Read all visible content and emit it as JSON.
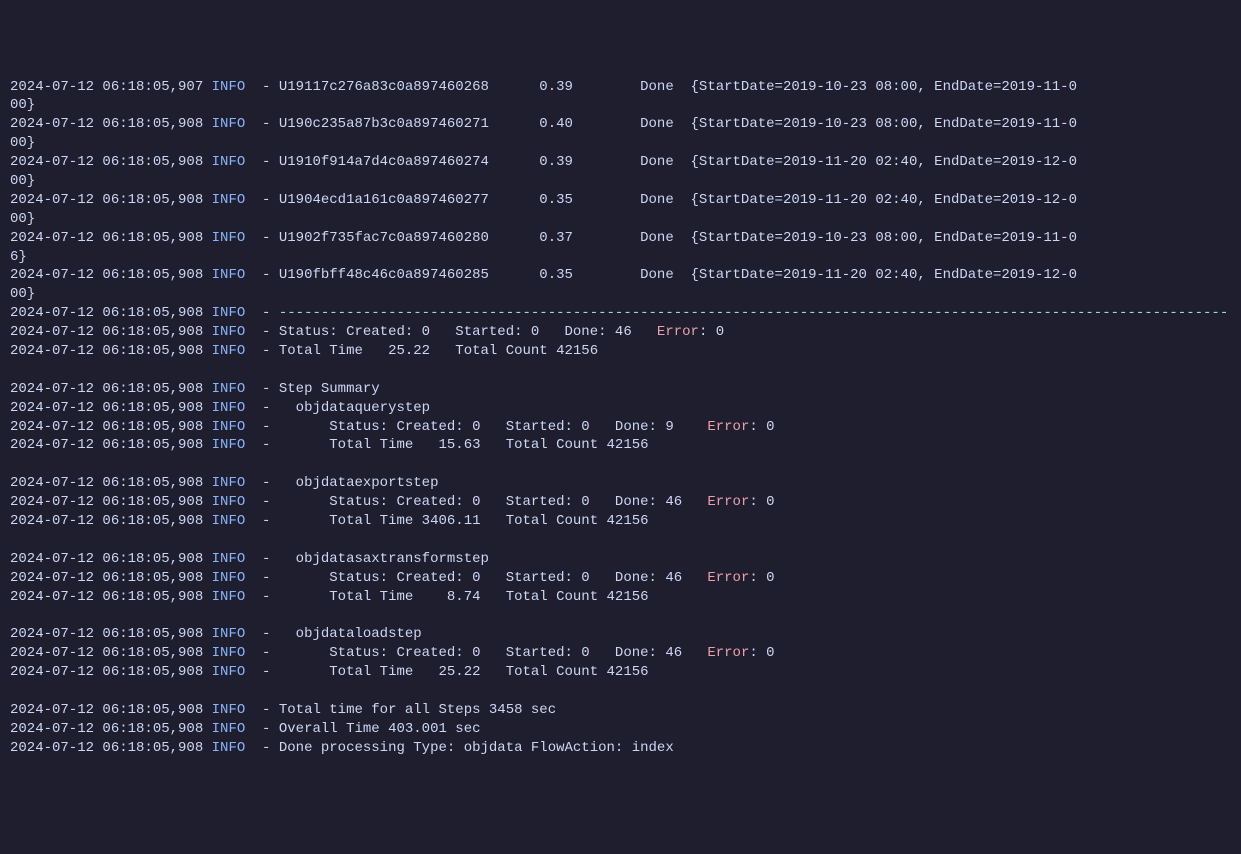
{
  "lines": [
    {
      "ts": "2024-07-12 06:18:05,907",
      "level": "INFO",
      "dash": "-",
      "id": "U19117c276a83c0a897460268",
      "val": "0.39",
      "status": "Done",
      "params": "{StartDate=2019-10-23 08:00, EndDate=2019-11-0"
    },
    {
      "wrap": "00}"
    },
    {
      "ts": "2024-07-12 06:18:05,908",
      "level": "INFO",
      "dash": "-",
      "id": "U190c235a87b3c0a897460271",
      "val": "0.40",
      "status": "Done",
      "params": "{StartDate=2019-10-23 08:00, EndDate=2019-11-0"
    },
    {
      "wrap": "00}"
    },
    {
      "ts": "2024-07-12 06:18:05,908",
      "level": "INFO",
      "dash": "-",
      "id": "U1910f914a7d4c0a897460274",
      "val": "0.39",
      "status": "Done",
      "params": "{StartDate=2019-11-20 02:40, EndDate=2019-12-0"
    },
    {
      "wrap": "00}"
    },
    {
      "ts": "2024-07-12 06:18:05,908",
      "level": "INFO",
      "dash": "-",
      "id": "U1904ecd1a161c0a897460277",
      "val": "0.35",
      "status": "Done",
      "params": "{StartDate=2019-11-20 02:40, EndDate=2019-12-0"
    },
    {
      "wrap": "00}"
    },
    {
      "ts": "2024-07-12 06:18:05,908",
      "level": "INFO",
      "dash": "-",
      "id": "U1902f735fac7c0a897460280",
      "val": "0.37",
      "status": "Done",
      "params": "{StartDate=2019-10-23 08:00, EndDate=2019-11-0"
    },
    {
      "wrap": "6}"
    },
    {
      "ts": "2024-07-12 06:18:05,908",
      "level": "INFO",
      "dash": "-",
      "id": "U190fbff48c46c0a897460285",
      "val": "0.35",
      "status": "Done",
      "params": "{StartDate=2019-11-20 02:40, EndDate=2019-12-0"
    },
    {
      "wrap": "00}"
    },
    {
      "ts": "2024-07-12 06:18:05,908",
      "level": "INFO",
      "dash": "-",
      "separator": true
    },
    {
      "ts": "2024-07-12 06:18:05,908",
      "level": "INFO",
      "dash": "-",
      "statusLine": {
        "created": "0",
        "started": "0",
        "done": "46",
        "error": "0"
      },
      "indent": ""
    },
    {
      "ts": "2024-07-12 06:18:05,908",
      "level": "INFO",
      "dash": "-",
      "msg": "Total Time   25.22   Total Count 42156"
    },
    {
      "blank": true
    },
    {
      "ts": "2024-07-12 06:18:05,908",
      "level": "INFO",
      "dash": "-",
      "msg": "Step Summary"
    },
    {
      "ts": "2024-07-12 06:18:05,908",
      "level": "INFO",
      "dash": "-",
      "msg": "  objdataquerystep"
    },
    {
      "ts": "2024-07-12 06:18:05,908",
      "level": "INFO",
      "dash": "-",
      "statusLine": {
        "created": "0",
        "started": "0",
        "done": "9",
        "error": "0"
      },
      "indent": "      ",
      "gap2": " "
    },
    {
      "ts": "2024-07-12 06:18:05,908",
      "level": "INFO",
      "dash": "-",
      "msg": "      Total Time   15.63   Total Count 42156"
    },
    {
      "blank": true
    },
    {
      "ts": "2024-07-12 06:18:05,908",
      "level": "INFO",
      "dash": "-",
      "msg": "  objdataexportstep"
    },
    {
      "ts": "2024-07-12 06:18:05,908",
      "level": "INFO",
      "dash": "-",
      "statusLine": {
        "created": "0",
        "started": "0",
        "done": "46",
        "error": "0"
      },
      "indent": "      "
    },
    {
      "ts": "2024-07-12 06:18:05,908",
      "level": "INFO",
      "dash": "-",
      "msg": "      Total Time 3406.11   Total Count 42156"
    },
    {
      "blank": true
    },
    {
      "ts": "2024-07-12 06:18:05,908",
      "level": "INFO",
      "dash": "-",
      "msg": "  objdatasaxtransformstep"
    },
    {
      "ts": "2024-07-12 06:18:05,908",
      "level": "INFO",
      "dash": "-",
      "statusLine": {
        "created": "0",
        "started": "0",
        "done": "46",
        "error": "0"
      },
      "indent": "      "
    },
    {
      "ts": "2024-07-12 06:18:05,908",
      "level": "INFO",
      "dash": "-",
      "msg": "      Total Time    8.74   Total Count 42156"
    },
    {
      "blank": true
    },
    {
      "ts": "2024-07-12 06:18:05,908",
      "level": "INFO",
      "dash": "-",
      "msg": "  objdataloadstep"
    },
    {
      "ts": "2024-07-12 06:18:05,908",
      "level": "INFO",
      "dash": "-",
      "statusLine": {
        "created": "0",
        "started": "0",
        "done": "46",
        "error": "0"
      },
      "indent": "      "
    },
    {
      "ts": "2024-07-12 06:18:05,908",
      "level": "INFO",
      "dash": "-",
      "msg": "      Total Time   25.22   Total Count 42156"
    },
    {
      "blank": true
    },
    {
      "ts": "2024-07-12 06:18:05,908",
      "level": "INFO",
      "dash": "-",
      "msg": "Total time for all Steps 3458 sec"
    },
    {
      "ts": "2024-07-12 06:18:05,908",
      "level": "INFO",
      "dash": "-",
      "msg": "Overall Time 403.001 sec"
    },
    {
      "ts": "2024-07-12 06:18:05,908",
      "level": "INFO",
      "dash": "-",
      "msg": "Done processing Type: objdata FlowAction: index"
    }
  ],
  "labels": {
    "status": "Status:",
    "created": "Created:",
    "started": "Started:",
    "done": "Done:",
    "error": "Error",
    "colon": ":"
  },
  "separator_char": "-----------------------------------------------------------------------------------------------------------------"
}
